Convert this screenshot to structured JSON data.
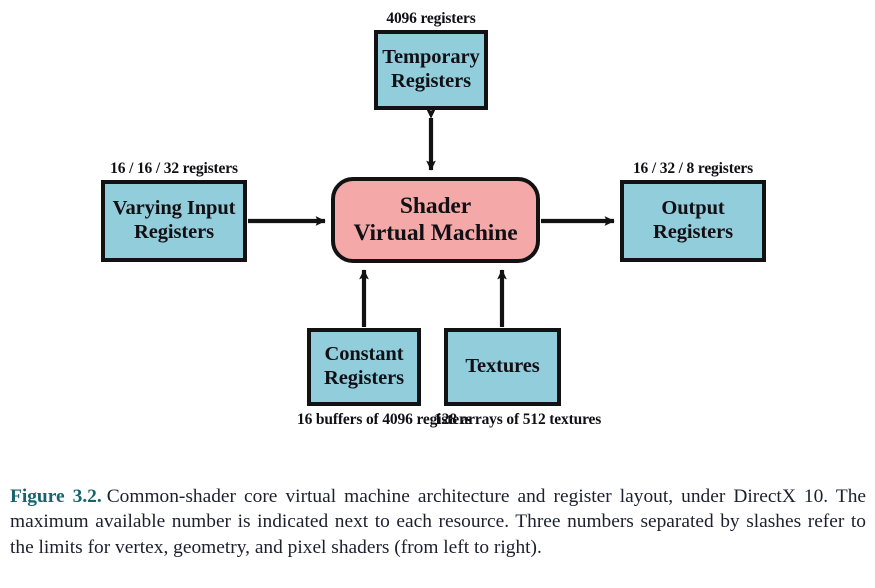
{
  "figure": {
    "label": "Figure 3.2.",
    "caption": "Common-shader core virtual machine architecture and register layout, under DirectX 10.  The maximum available number is indicated next to each resource.  Three numbers separated by slashes refer to the limits for vertex, geometry, and pixel shaders (from left to right)."
  },
  "colors": {
    "register_box_fill": "#92cddc",
    "virtual_machine_fill": "#f4a9a8",
    "stroke": "#121212",
    "figure_label": "#16646f",
    "caption_text": "#1b1f2e"
  },
  "diagram": {
    "nodes": {
      "temporary_registers": {
        "title_line1": "Temporary",
        "title_line2": "Registers",
        "annotation": "4096 registers"
      },
      "varying_input_registers": {
        "title_line1": "Varying Input",
        "title_line2": "Registers",
        "annotation": "16 / 16 / 32 registers"
      },
      "shader_virtual_machine": {
        "title_line1": "Shader",
        "title_line2": "Virtual Machine"
      },
      "output_registers": {
        "title_line1": "Output",
        "title_line2": "Registers",
        "annotation": "16 / 32 / 8 registers"
      },
      "constant_registers": {
        "title_line1": "Constant",
        "title_line2": "Registers",
        "annotation_line1": "16 buffers of",
        "annotation_line2": "4096 registers"
      },
      "textures": {
        "title_line1": "Textures",
        "annotation_line1": "128 arrays of",
        "annotation_line2": "512 textures"
      }
    },
    "connections": [
      {
        "name": "temporary-to-vm",
        "from": "temporary_registers",
        "to": "shader_virtual_machine",
        "arrow": "double"
      },
      {
        "name": "varying-to-vm",
        "from": "varying_input_registers",
        "to": "shader_virtual_machine",
        "arrow": "single"
      },
      {
        "name": "vm-to-output",
        "from": "shader_virtual_machine",
        "to": "output_registers",
        "arrow": "single"
      },
      {
        "name": "constant-to-vm",
        "from": "constant_registers",
        "to": "shader_virtual_machine",
        "arrow": "single"
      },
      {
        "name": "textures-to-vm",
        "from": "textures",
        "to": "shader_virtual_machine",
        "arrow": "single"
      }
    ]
  }
}
